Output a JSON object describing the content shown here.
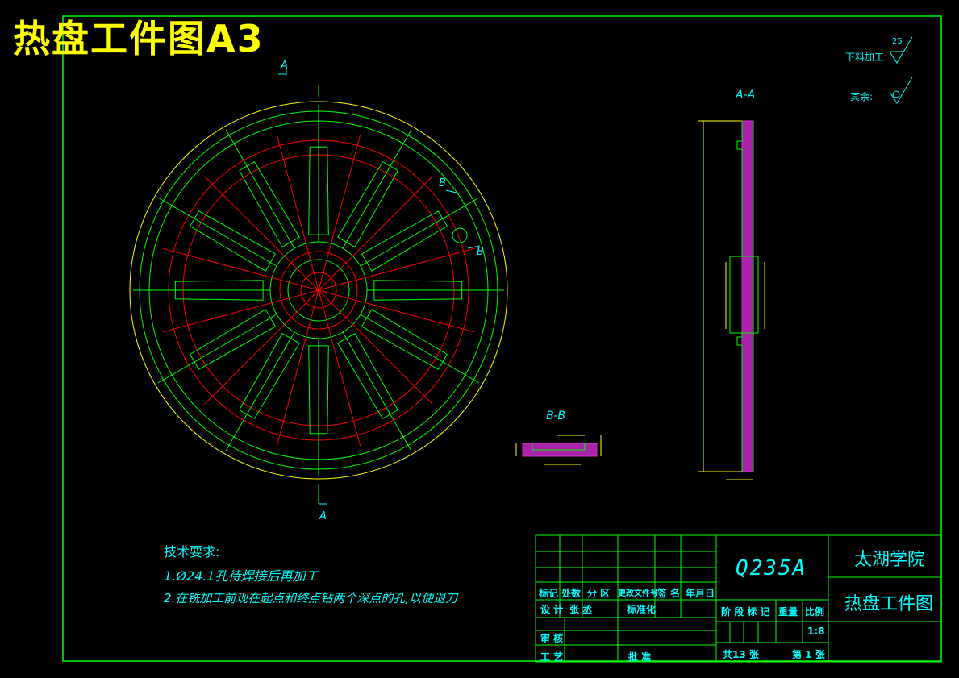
{
  "sheet_title": "热盘工件图A3",
  "roughness": {
    "blank_label": "下料加工:",
    "blank_value": "25",
    "other_label": "其余:"
  },
  "section_labels": {
    "aa_top_mark": "A",
    "aa_bottom_mark": "A",
    "bb_top_mark": "B",
    "bb_bottom_mark": "B",
    "aa_title": "A-A",
    "bb_title": "B-B"
  },
  "tech_notes": {
    "heading": "技术要求:",
    "items": [
      "1.Ø24.1孔待焊接后再加工",
      "2.在铣加工前现在起点和终点钻两个深点的孔,以便退刀"
    ]
  },
  "title_block": {
    "material": "Q235A",
    "school": "太湖学院",
    "part_name": "热盘工件图",
    "header_labels": [
      "标记",
      "处数",
      "分 区",
      "更改文件号",
      "签 名",
      "年月日"
    ],
    "design_label": "设 计",
    "designer": "张 丞",
    "standard_label": "标准化",
    "stage_labels": [
      "阶 段 标 记",
      "重量",
      "比例"
    ],
    "scale": "1:8",
    "review_label": "审 核",
    "process_label": "工 艺",
    "approve_label": "批 准",
    "sheets_total": "共13 张",
    "sheet_no": "第 1 张"
  },
  "colors": {
    "frame": "#00ff00",
    "title": "#ffff00",
    "text": "#00ffff",
    "red": "#ff0000",
    "hatch": "#cc33cc"
  }
}
